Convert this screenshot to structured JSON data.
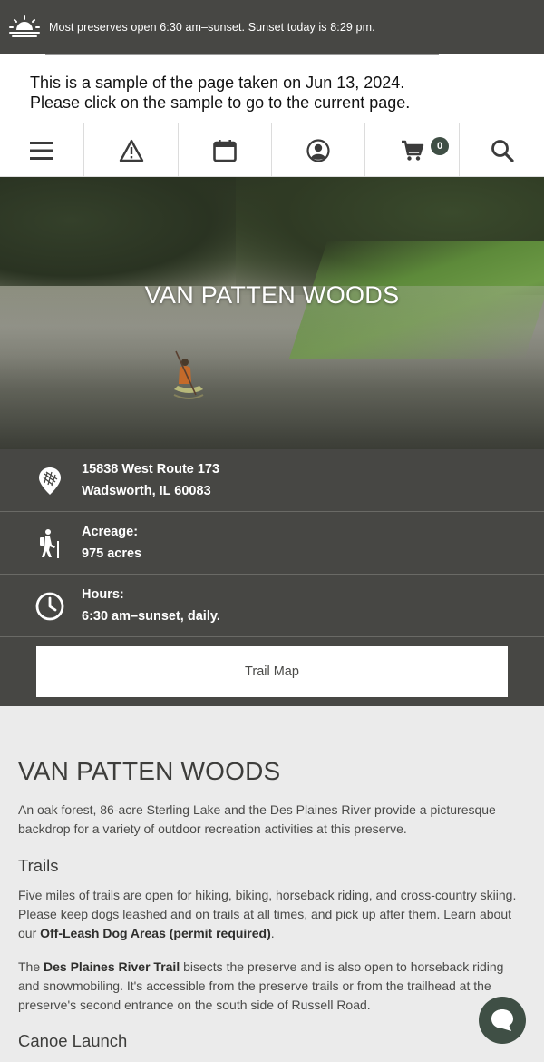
{
  "topbar": {
    "message": "Most preserves open 6:30 am–sunset. Sunset today is 8:29 pm."
  },
  "sample": {
    "line1": "This is a sample of the page taken on Jun 13, 2024.",
    "line2": "Please click on the sample to go to the current page."
  },
  "nav": {
    "cart_count": "0"
  },
  "hero": {
    "title": "VAN PATTEN WOODS"
  },
  "info": {
    "address_line1": "15838 West Route 173",
    "address_line2": "Wadsworth, IL 60083",
    "acreage_label": "Acreage:",
    "acreage_value": "975 acres",
    "hours_label": "Hours:",
    "hours_value": "6:30 am–sunset, daily.",
    "trail_map_label": "Trail Map"
  },
  "content": {
    "heading": "VAN PATTEN WOODS",
    "intro": "An oak forest, 86-acre Sterling Lake and the Des Plaines River provide a picturesque backdrop for a variety of outdoor recreation activities at this preserve.",
    "trails_heading": "Trails",
    "trails_p1_text": "Five miles of trails are open for hiking, biking, horseback riding, and cross-country skiing. Please keep dogs leashed and on trails at all times, and pick up after them. Learn about our ",
    "trails_p1_link": "Off-Leash Dog Areas (permit required)",
    "trails_p1_end": ".",
    "trails_p2_start": "The ",
    "trails_p2_link": "Des Plaines River Trail",
    "trails_p2_rest": " bisects the preserve and is also open to horseback riding and snowmobiling. It's accessible from the preserve trails or from the trailhead at the preserve's second entrance on the south side of Russell Road.",
    "canoe_heading": "Canoe Launch"
  },
  "colors": {
    "dark_bar": "#474744",
    "accent_green": "#3f4f45",
    "page_bg": "#ebebeb"
  }
}
